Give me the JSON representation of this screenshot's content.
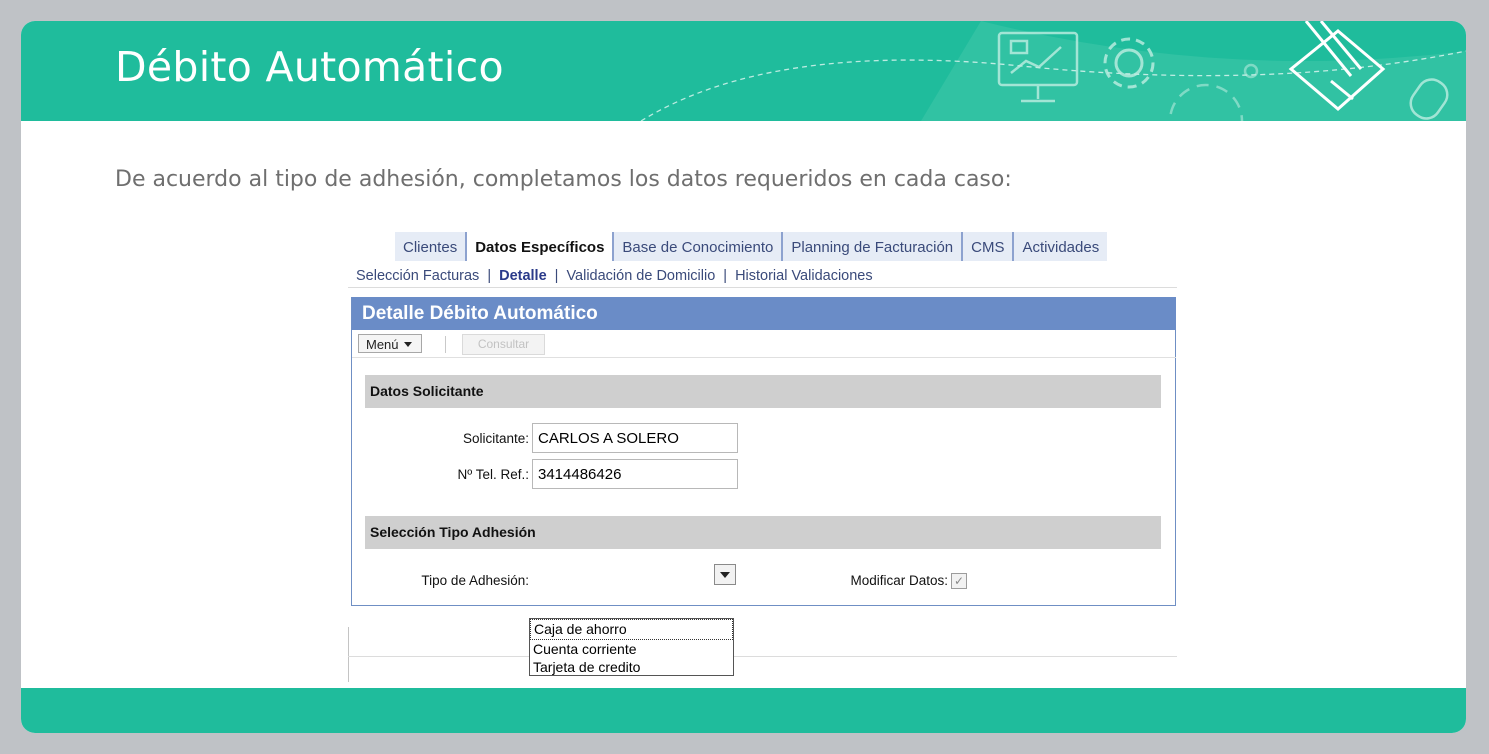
{
  "slide": {
    "title": "Débito Automático",
    "subtitle": "De acuerdo al tipo de adhesión, completamos los datos requeridos en cada caso:",
    "header_color": "#1fbc9c",
    "decor_icons": [
      "monitor-chart-icon",
      "gear-icon",
      "gear-large-icon",
      "pencil-diamond-icon",
      "mouse-icon"
    ]
  },
  "tabs": [
    {
      "label": "Clientes"
    },
    {
      "label": "Datos Específicos",
      "active": true
    },
    {
      "label": "Base de Conocimiento"
    },
    {
      "label": "Planning de Facturación"
    },
    {
      "label": "CMS"
    },
    {
      "label": "Actividades"
    }
  ],
  "subtabs": [
    {
      "label": "Selección Facturas"
    },
    {
      "label": "Detalle",
      "active": true
    },
    {
      "label": "Validación de Domicilio"
    },
    {
      "label": "Historial Validaciones"
    }
  ],
  "panel": {
    "title": "Detalle Débito Automático",
    "accent_color": "#6a8cc7",
    "toolbar": {
      "menu_label": "Menú",
      "consultar_label": "Consultar"
    }
  },
  "datos_solicitante": {
    "section_title": "Datos Solicitante",
    "solicitante_label": "Solicitante:",
    "solicitante_value": "CARLOS A SOLERO",
    "telefono_label": "Nº Tel. Ref.:",
    "telefono_value": "3414486426"
  },
  "adhesion": {
    "section_title": "Selección Tipo Adhesión",
    "tipo_label": "Tipo de Adhesión:",
    "tipo_value": "",
    "modificar_label": "Modificar Datos:",
    "modificar_checked": true,
    "options": [
      "Caja de ahorro",
      "Cuenta corriente",
      "Tarjeta de credito"
    ]
  }
}
